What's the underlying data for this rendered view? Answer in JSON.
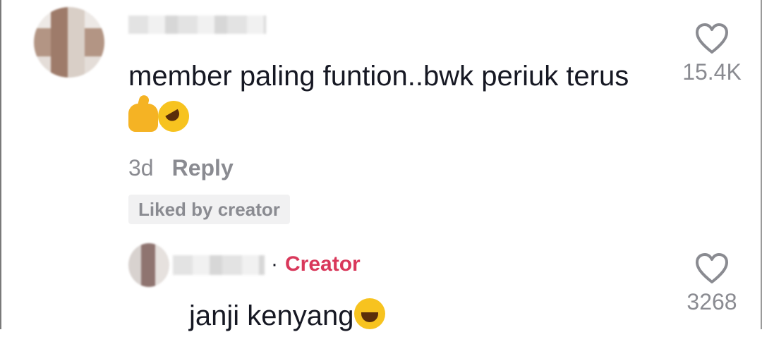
{
  "comments": [
    {
      "text": "member paling funtion..bwk periuk terus",
      "emojis": [
        "thumbs-up",
        "rolling-on-floor-laughing"
      ],
      "time": "3d",
      "reply_label": "Reply",
      "badge": "Liked by creator",
      "like_count": "15.4K"
    },
    {
      "text": "janji kenyang",
      "emojis": [
        "face-with-tears-of-joy"
      ],
      "creator_tag": "Creator",
      "separator": "·",
      "like_count": "3268"
    }
  ],
  "colors": {
    "text": "#161823",
    "muted": "#8a8b91",
    "creator": "#d9385b",
    "badge_bg": "#f1f1f2"
  }
}
